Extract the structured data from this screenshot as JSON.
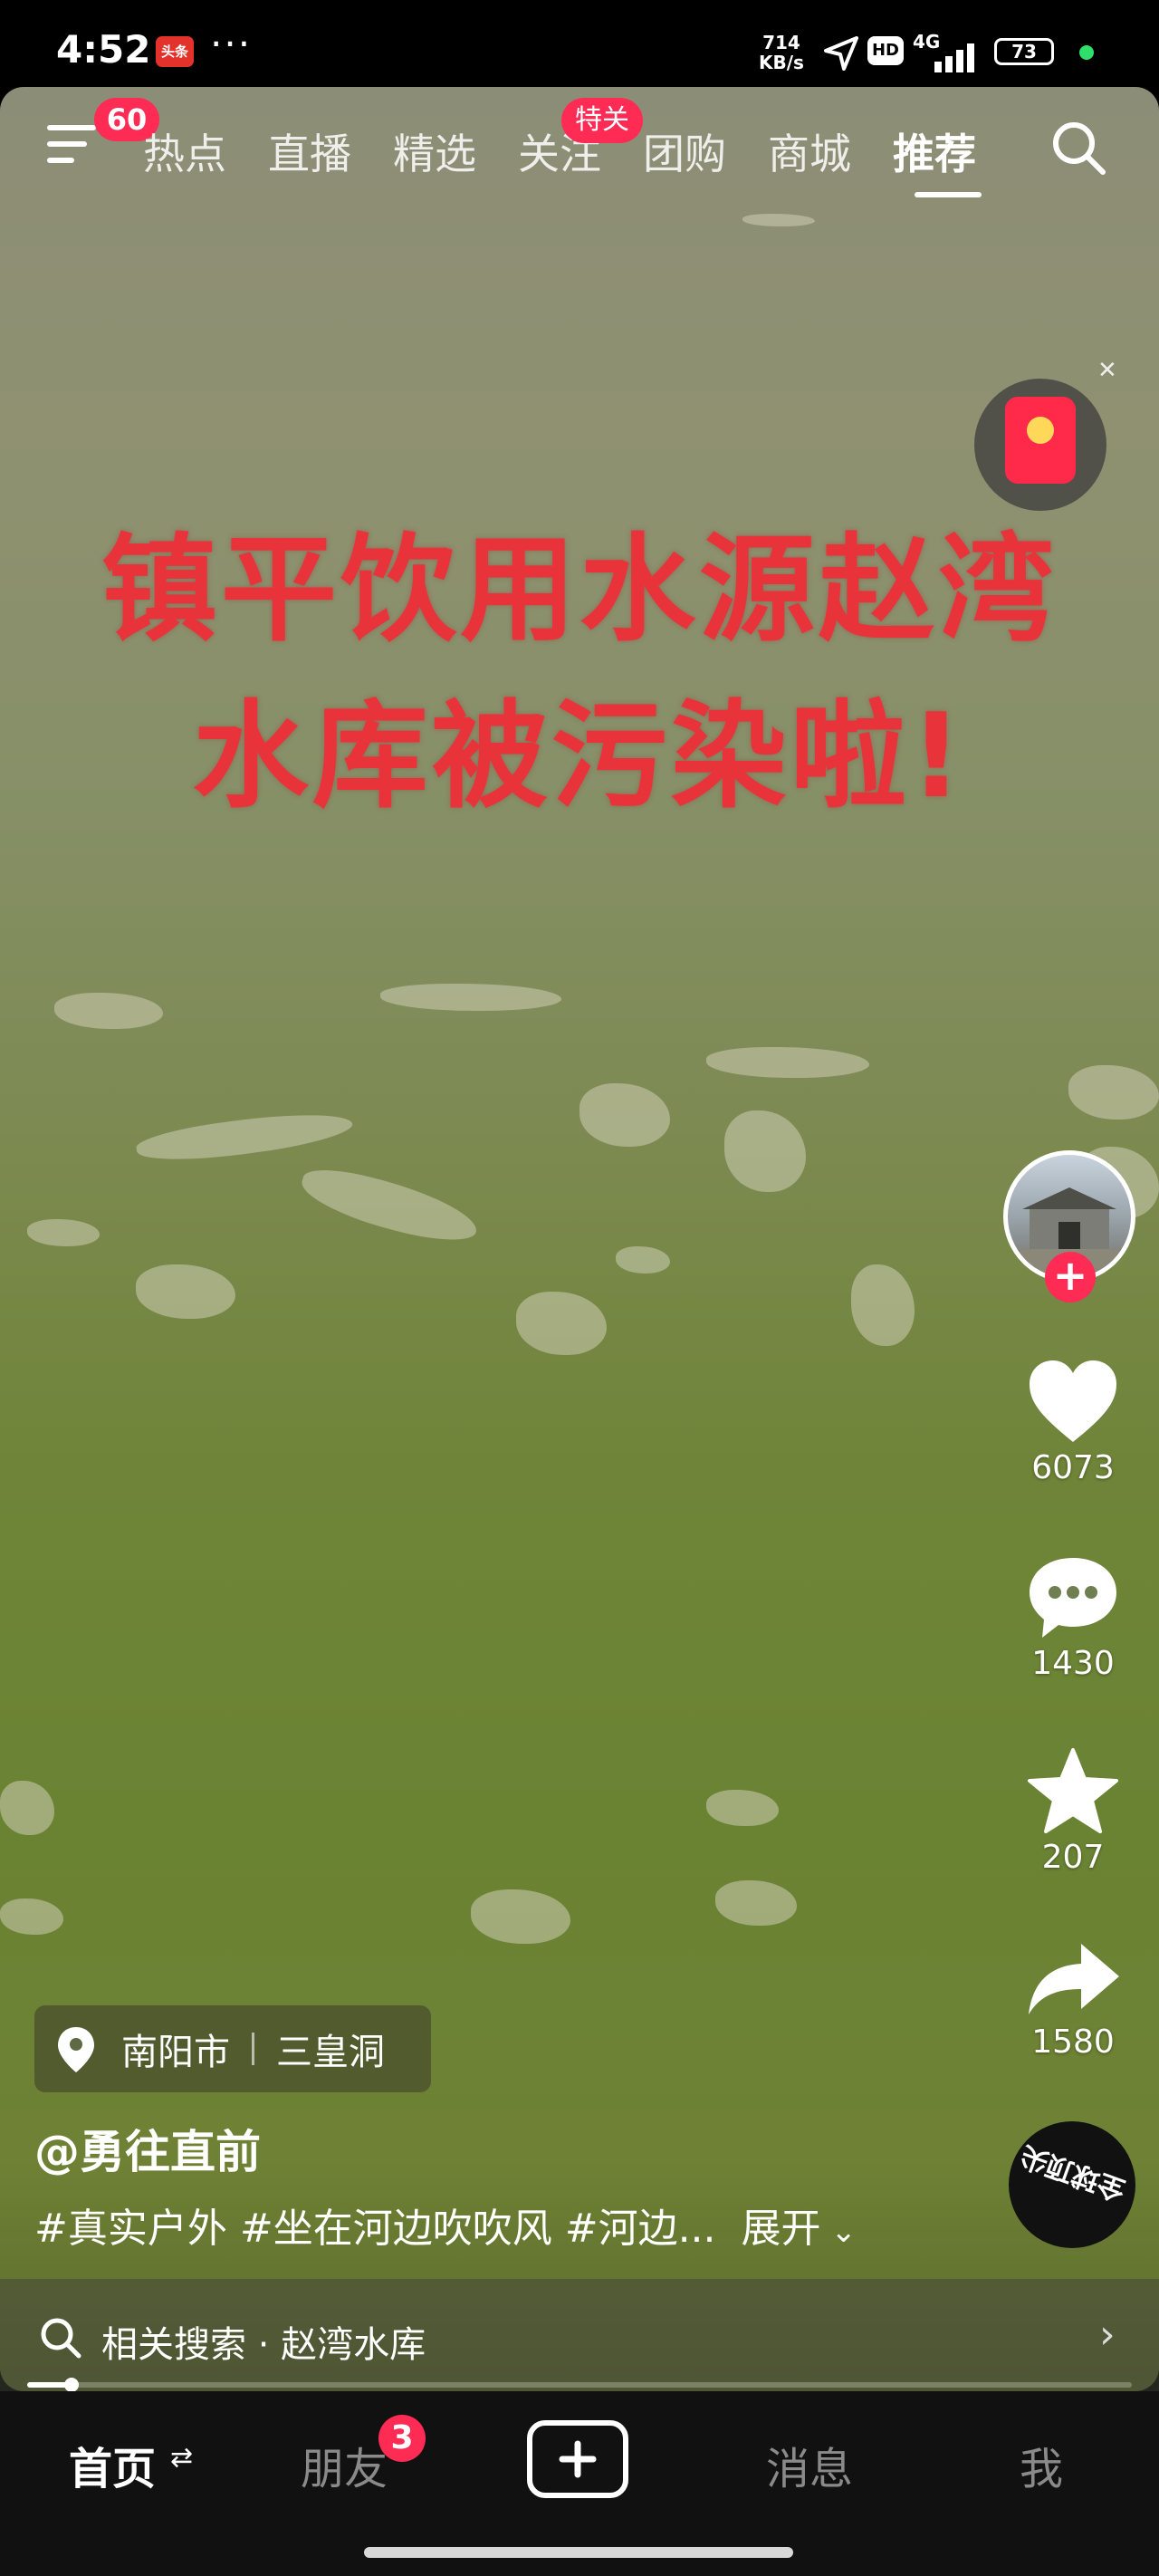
{
  "status_bar": {
    "time": "4:52",
    "app_badge": "头条",
    "dots": "···",
    "net_speed_value": "714",
    "net_speed_unit": "KB/s",
    "hd_label": "HD",
    "network": "4G",
    "battery": "73",
    "charge_dot_color": "#2ee06a"
  },
  "top_tabs": {
    "menu_badge": "60",
    "items": [
      {
        "label": "热点"
      },
      {
        "label": "直播"
      },
      {
        "label": "精选"
      },
      {
        "label": "关注",
        "badge": "特关"
      },
      {
        "label": "团购"
      },
      {
        "label": "商城"
      },
      {
        "label": "推荐",
        "active": true
      }
    ]
  },
  "video": {
    "overlay_line1": "镇平饮用水源赵湾",
    "overlay_line2": "水库被污染啦!"
  },
  "actions": {
    "likes": "6073",
    "comments": "1430",
    "favorites": "207",
    "shares": "1580",
    "music_disc_text": "全球顶尖"
  },
  "info": {
    "location_city": "南阳市",
    "location_place": "三皇洞",
    "author": "@勇往直前",
    "caption": "#真实户外 #坐在河边吹吹风 #河边...",
    "expand_label": "展开",
    "related_search": "相关搜索 · 赵湾水库",
    "progress": 0.04
  },
  "bottom_nav": {
    "home": "首页",
    "friends": "朋友",
    "friends_badge": "3",
    "messages": "消息",
    "me": "我"
  },
  "colors": {
    "accent": "#fe2c55",
    "overlay_text": "#e8333b"
  }
}
